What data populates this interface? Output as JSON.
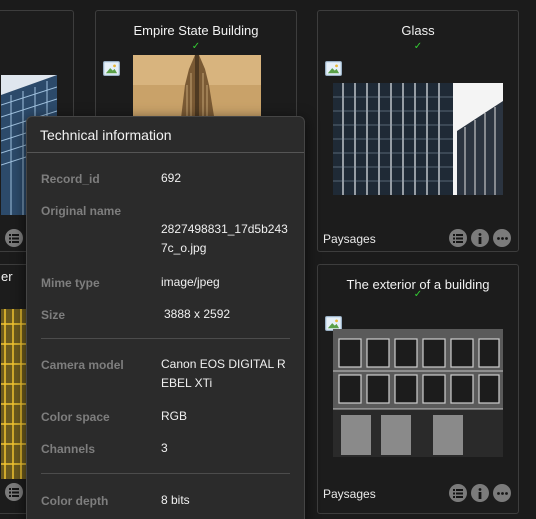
{
  "cards": [
    {
      "title": "",
      "collection": ""
    },
    {
      "title": "Empire State Building",
      "status_icon": "check-icon",
      "collection": ""
    },
    {
      "title": "Glass",
      "status_icon": "check-icon",
      "collection": "Paysages"
    },
    {
      "title": "",
      "collection": ""
    },
    {
      "title": "The exterior of a building",
      "status_icon": "check-icon",
      "collection": "Paysages"
    }
  ],
  "left_card_bottom_fragment": "er",
  "check_glyph": "✓",
  "actions": {
    "list_icon": "list-icon",
    "info_icon": "info-icon",
    "more_icon": "more-icon"
  },
  "technical_info": {
    "title": "Technical information",
    "rows": [
      {
        "label": "Record_id",
        "value": "692"
      },
      {
        "label": "Original name",
        "value": "2827498831_17d5b2437c_o.jpg"
      },
      {
        "label": "Mime type",
        "value": "image/jpeg"
      },
      {
        "label": "Size",
        "value": "3888 x 2592"
      },
      {
        "label": "Camera model",
        "value": "Canon EOS DIGITAL REBEL XTi"
      },
      {
        "label": "Color space",
        "value": "RGB"
      },
      {
        "label": "Channels",
        "value": "3"
      },
      {
        "label": "Color depth",
        "value": "8 bits"
      }
    ]
  },
  "colors": {
    "background": "#1b1b1b",
    "card_border": "#3d3d3d",
    "check": "#33cc33",
    "popover_bg": "#2b2b2b",
    "label": "#7e7e7e"
  }
}
